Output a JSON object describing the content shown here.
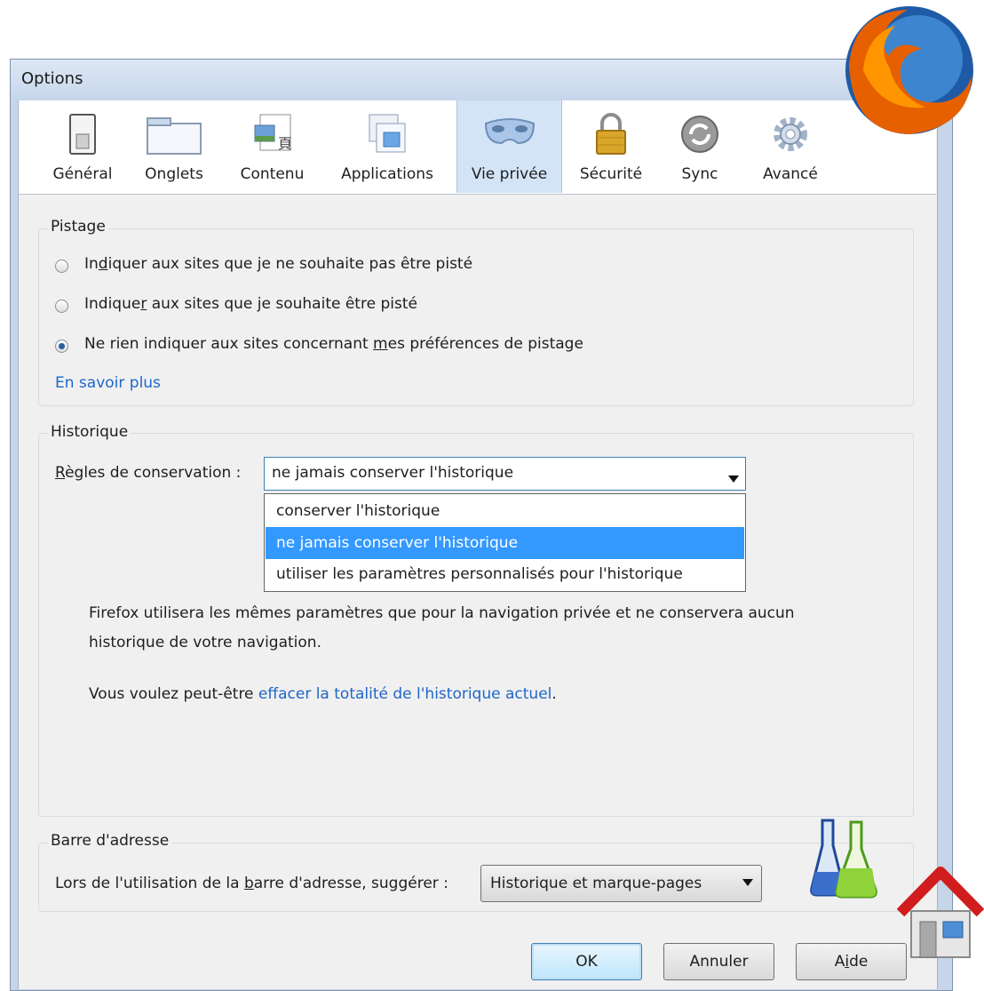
{
  "window": {
    "title": "Options"
  },
  "toolbar": {
    "tabs": [
      {
        "label": "Général",
        "icon": "general-switch-icon"
      },
      {
        "label": "Onglets",
        "icon": "tabs-window-icon"
      },
      {
        "label": "Contenu",
        "icon": "content-page-icon"
      },
      {
        "label": "Applications",
        "icon": "applications-icon"
      },
      {
        "label": "Vie privée",
        "icon": "privacy-mask-icon"
      },
      {
        "label": "Sécurité",
        "icon": "padlock-icon"
      },
      {
        "label": "Sync",
        "icon": "sync-icon"
      },
      {
        "label": "Avancé",
        "icon": "gear-icon"
      }
    ],
    "selected": "Vie privée"
  },
  "tracking": {
    "legend": "Pistage",
    "options": [
      {
        "pre": "In",
        "key": "d",
        "post": "iquer aux sites que je ne souhaite pas être pisté",
        "checked": false
      },
      {
        "pre": "Indique",
        "key": "r",
        "post": " aux sites que je souhaite être pisté",
        "checked": false
      },
      {
        "pre": "Ne rien indiquer aux sites concernant ",
        "key": "m",
        "post": "es préférences de pistage",
        "checked": true
      }
    ],
    "learn_more": "En savoir plus"
  },
  "history": {
    "legend": "Historique",
    "rule_label_key": "R",
    "rule_label_rest": "ègles de conservation :",
    "selected_value": "ne jamais conserver l'historique",
    "options": [
      "conserver l'historique",
      "ne jamais conserver l'historique",
      "utiliser les paramètres personnalisés pour l'historique"
    ],
    "highlighted_option": "ne jamais conserver l'historique",
    "description": "Firefox utilisera les mêmes paramètres que pour la navigation privée et ne conservera aucun historique de votre navigation.",
    "clear_pre": "Vous voulez peut-être ",
    "clear_link": "effacer la totalité de l'historique actuel",
    "clear_post": "."
  },
  "address_bar": {
    "legend": "Barre d'adresse",
    "label_pre": "Lors de l'utilisation de la ",
    "label_key": "b",
    "label_post": "arre d'adresse, suggérer :",
    "selected_value": "Historique et marque-pages"
  },
  "buttons": {
    "ok": "OK",
    "cancel": "Annuler",
    "help_pre": "A",
    "help_key": "i",
    "help_post": "de"
  },
  "colors": {
    "accent": "#3399ff",
    "link": "#1f66c8",
    "selected_tab": "#d4e4f7"
  },
  "decorations": [
    "firefox-logo",
    "lab-flasks-icon",
    "home-icon"
  ]
}
